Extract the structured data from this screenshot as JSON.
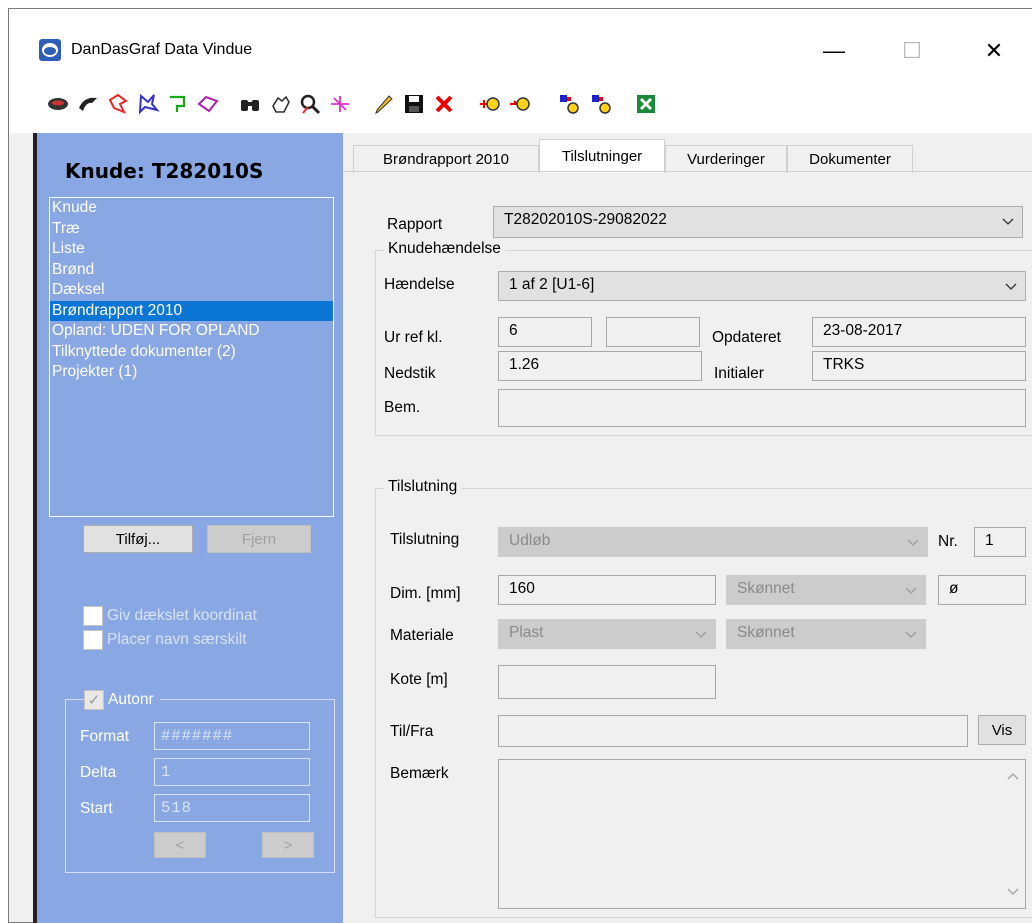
{
  "window": {
    "title": "DanDasGraf  Data Vindue",
    "min_label": "—",
    "max_label": "☐",
    "close_label": "✕"
  },
  "toolbar_icons": [
    "ellipse-icon",
    "cut-icon",
    "polygon-red-icon",
    "polygon-blue-icon",
    "polyline-green-icon",
    "diamond-icon",
    "binoculars-icon",
    "hand-icon",
    "zoom-icon",
    "split-icon",
    "pencil-icon",
    "save-icon",
    "delete-icon",
    "connect-left-icon",
    "connect-right-icon",
    "link-node-a-icon",
    "link-node-b-icon",
    "close-green-icon"
  ],
  "left": {
    "node_title": "Knude: T282010S",
    "tree_items": [
      "Knude",
      "Træ",
      "Liste",
      "Brønd",
      "Dæksel",
      "Brøndrapport 2010",
      "Opland: UDEN FOR OPLAND",
      "Tilknyttede dokumenter (2)",
      "Projekter (1)"
    ],
    "selected_index": 5,
    "add_button": "Tilføj...",
    "remove_button": "Fjern",
    "chk_coordinate": "Giv dækslet koordinat",
    "chk_name": "Placer navn særskilt",
    "autonr": {
      "legend": "Autonr",
      "format_label": "Format",
      "format_value": "#######",
      "delta_label": "Delta",
      "delta_value": "1",
      "start_label": "Start",
      "start_value": "518",
      "prev": "<",
      "next": ">"
    }
  },
  "tabs": [
    "Brøndrapport 2010",
    "Tilslutninger",
    "Vurderinger",
    "Dokumenter"
  ],
  "active_tab": 1,
  "rapport": {
    "label": "Rapport",
    "value": "T28202010S-29082022"
  },
  "knudehaendelse": {
    "legend": "Knudehændelse",
    "haendelse_label": "Hændelse",
    "haendelse_value": "1 af 2 [U1-6]",
    "urref_label": "Ur ref kl.",
    "urref_value": "6",
    "urref_extra": "",
    "opdateret_label": "Opdateret",
    "opdateret_value": "23-08-2017",
    "nedstik_label": "Nedstik",
    "nedstik_value": "1.26",
    "initialer_label": "Initialer",
    "initialer_value": "TRKS",
    "bem_label": "Bem.",
    "bem_value": ""
  },
  "tilslutning": {
    "legend": "Tilslutning",
    "tilslutning_label": "Tilslutning",
    "tilslutning_value": "Udløb",
    "nr_label": "Nr.",
    "nr_value": "1",
    "dim_label": "Dim. [mm]",
    "dim_value": "160",
    "dim_quality": "Skønnet",
    "dim_symbol": "ø",
    "materiale_label": "Materiale",
    "materiale_value": "Plast",
    "materiale_quality": "Skønnet",
    "kote_label": "Kote [m]",
    "kote_value": "",
    "tilfra_label": "Til/Fra",
    "tilfra_value": "",
    "vis_button": "Vis",
    "bemaerk_label": "Bemærk",
    "bemaerk_value": ""
  }
}
